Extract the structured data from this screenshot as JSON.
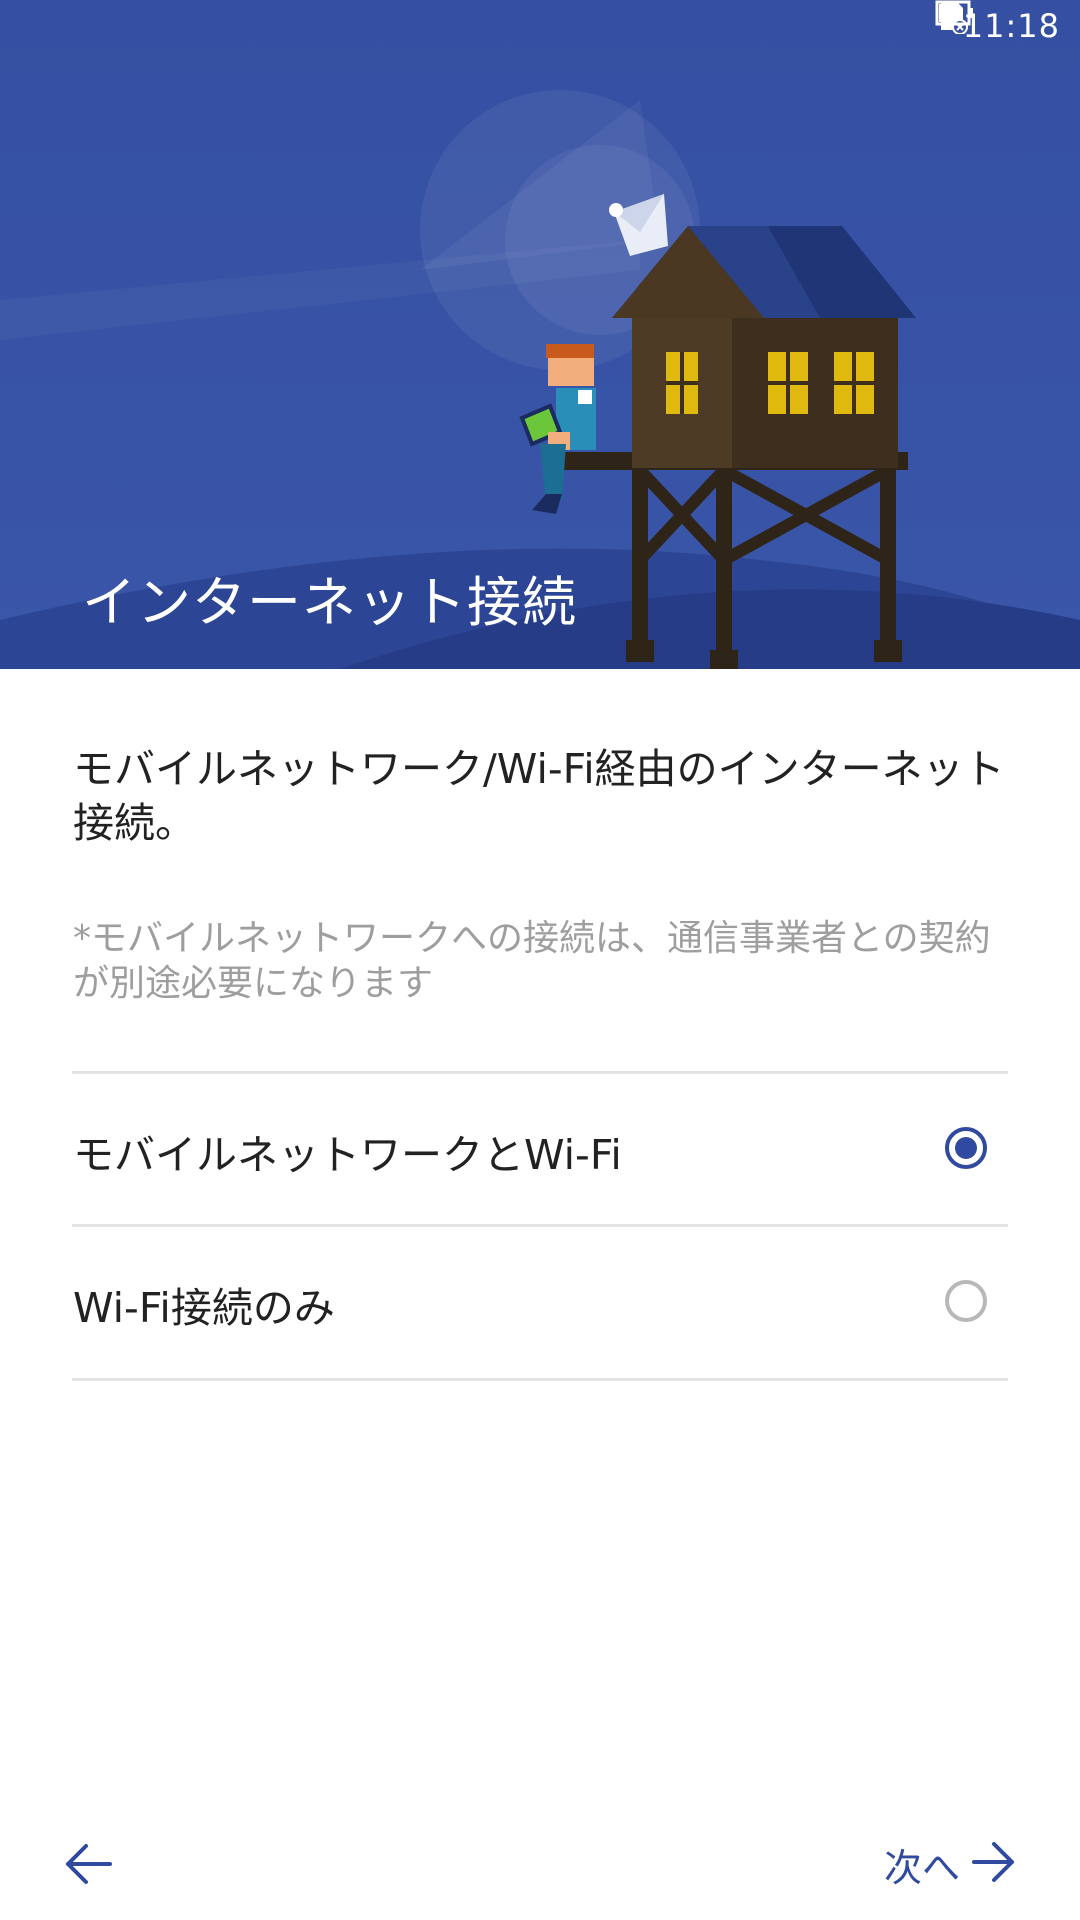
{
  "status_bar": {
    "time": "11:18",
    "icons": [
      "sd-card-error-icon",
      "battery-icon"
    ]
  },
  "header": {
    "title": "インターネット接続"
  },
  "content": {
    "description": "モバイルネットワーク/Wi-Fi経由のインターネット接続。",
    "note": "*モバイルネットワークへの接続は、通信事業者との契約が別途必要になります"
  },
  "options": [
    {
      "label": "モバイルネットワークとWi-Fi",
      "selected": true
    },
    {
      "label": "Wi-Fi接続のみ",
      "selected": false
    }
  ],
  "footer": {
    "back_icon": "arrow-left-icon",
    "next_label": "次へ",
    "next_icon": "arrow-right-icon"
  },
  "colors": {
    "accent": "#2f4a9e",
    "header_bg": "#3550a3",
    "text_primary": "#222222",
    "text_secondary": "#9e9e9e",
    "divider": "#e3e3e3"
  }
}
